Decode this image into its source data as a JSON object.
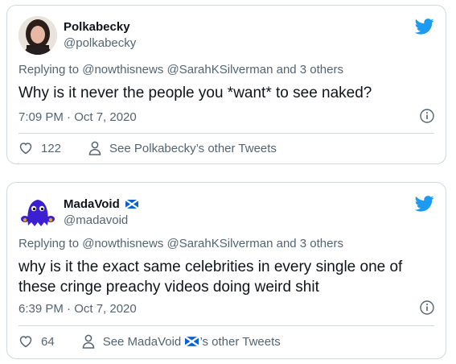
{
  "tweets": [
    {
      "name": "Polkabecky",
      "handle": "@polkabecky",
      "replying": "Replying to @nowthisnews @SarahKSilverman and 3 others",
      "body": "Why is it never the people you *want* to see naked?",
      "time": "7:09 PM · Oct 7, 2020",
      "likes": "122",
      "see_other": "See Polkabecky’s other Tweets"
    },
    {
      "name": "MadaVoid",
      "handle": "@madavoid",
      "replying": "Replying to @nowthisnews @SarahKSilverman and 3 others",
      "body_line1": "why is it the exact same celebrities in every single one of",
      "body_line2": "these cringe preachy videos doing weird shit",
      "time": "6:39 PM · Oct 7, 2020",
      "likes": "64",
      "see_other_prefix": "See MadaVoid ",
      "see_other_suffix": "’s other Tweets"
    }
  ],
  "colors": {
    "twitter_blue": "#1d9bf0",
    "muted_text": "#536471",
    "border": "#cfd9de"
  },
  "icons": [
    "twitter-bird-icon",
    "info-icon",
    "heart-icon",
    "person-icon",
    "scotland-flag-icon"
  ]
}
